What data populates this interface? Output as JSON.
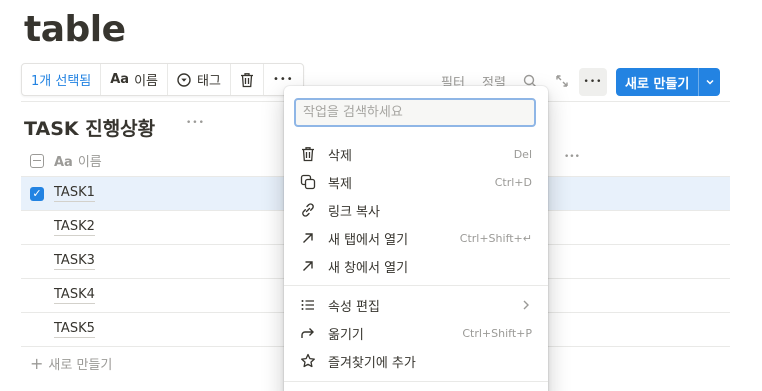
{
  "page": {
    "title": "table"
  },
  "bulk_toolbar": {
    "selected_label": "1개 선택됨",
    "name_prefix": "Aa",
    "name_label": "이름",
    "tag_label": "태그",
    "more_glyph": "•••"
  },
  "view_toolbar": {
    "filter_label": "필터",
    "sort_label": "정렬",
    "more_glyph": "•••",
    "new_button_label": "새로 만들기"
  },
  "database": {
    "title": "TASK 진행상황",
    "more_glyph": "•••",
    "column_prefix": "Aa",
    "column_name": "이름",
    "header_more_glyph": "•••",
    "rows": [
      {
        "name": "TASK1",
        "selected": true
      },
      {
        "name": "TASK2",
        "selected": false
      },
      {
        "name": "TASK3",
        "selected": false
      },
      {
        "name": "TASK4",
        "selected": false
      },
      {
        "name": "TASK5",
        "selected": false
      }
    ],
    "add_row_label": "새로 만들기"
  },
  "context_menu": {
    "search_placeholder": "작업을 검색하세요",
    "items": [
      {
        "label": "삭제",
        "shortcut": "Del",
        "icon": "trash-icon"
      },
      {
        "label": "복제",
        "shortcut": "Ctrl+D",
        "icon": "duplicate-icon"
      },
      {
        "label": "링크 복사",
        "shortcut": "",
        "icon": "link-icon"
      },
      {
        "label": "새 탭에서 열기",
        "shortcut": "Ctrl+Shift+↵",
        "icon": "arrow-up-right-icon"
      },
      {
        "label": "새 창에서 열기",
        "shortcut": "",
        "icon": "arrow-up-right-icon"
      },
      {
        "label": "속성 편집",
        "shortcut": "",
        "icon": "list-icon"
      },
      {
        "label": "옮기기",
        "shortcut": "Ctrl+Shift+P",
        "icon": "move-arrow-icon"
      },
      {
        "label": "즐겨찾기에 추가",
        "shortcut": "",
        "icon": "star-icon"
      }
    ]
  },
  "colors": {
    "accent": "#2383e2",
    "selected_row": "#e8f1fb",
    "text": "#37352f",
    "muted": "#9b9a97"
  }
}
